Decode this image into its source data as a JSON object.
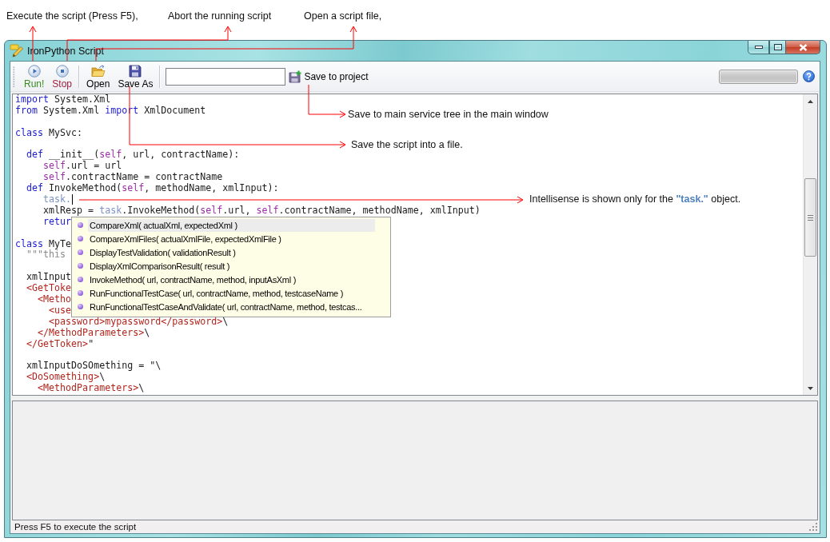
{
  "annotations": {
    "top": [
      "Execute the script (Press F5),",
      "Abort the running script",
      "Open a script file,"
    ],
    "side": [
      "Save to main service tree in the main window",
      "Save the script into a file.",
      "Intellisense is shown only for the **\"task.\"** object."
    ]
  },
  "window": {
    "title": "IronPython Script"
  },
  "toolbar": {
    "buttons": [
      {
        "kind": "run",
        "label": "Run!"
      },
      {
        "kind": "stop",
        "label": "Stop"
      },
      {
        "kind": "open",
        "label": "Open"
      },
      {
        "kind": "save_as",
        "label": "Save As"
      }
    ],
    "save_to_project": "Save to project"
  },
  "editor": {
    "lines": [
      {
        "segments": [
          {
            "kind": "keyword",
            "text": "import"
          },
          {
            "kind": "plain",
            "text": " System.Xml"
          }
        ],
        "caret": false
      },
      {
        "segments": [
          {
            "kind": "keyword",
            "text": "from"
          },
          {
            "kind": "plain",
            "text": " System.Xml "
          },
          {
            "kind": "keyword",
            "text": "import"
          },
          {
            "kind": "plain",
            "text": " XmlDocument"
          }
        ],
        "caret": false
      },
      {
        "caret": false
      },
      {
        "segments": [
          {
            "kind": "keyword",
            "text": "class"
          },
          {
            "kind": "plain",
            "text": " MySvc:"
          }
        ],
        "caret": false
      },
      {
        "caret": false
      },
      {
        "segments": [
          {
            "kind": "keyword",
            "text": "  def"
          },
          {
            "kind": "plain",
            "text": " __init__("
          },
          {
            "kind": "self",
            "text": "self"
          },
          {
            "kind": "plain",
            "text": ", url, contractName):"
          }
        ],
        "caret": false
      },
      {
        "segments": [
          {
            "kind": "self",
            "text": "     self"
          },
          {
            "kind": "plain",
            "text": ".url = url"
          }
        ],
        "caret": false
      },
      {
        "segments": [
          {
            "kind": "self",
            "text": "     self"
          },
          {
            "kind": "plain",
            "text": ".contractName = contractName"
          }
        ],
        "caret": false
      },
      {
        "segments": [
          {
            "kind": "keyword",
            "text": "  def"
          },
          {
            "kind": "plain",
            "text": " InvokeMethod("
          },
          {
            "kind": "self",
            "text": "self"
          },
          {
            "kind": "plain",
            "text": ", methodName, xmlInput):"
          }
        ],
        "caret": false
      },
      {
        "segments": [
          {
            "kind": "task",
            "text": "     task."
          }
        ],
        "caret": true
      },
      {
        "segments": [
          {
            "kind": "plain",
            "text": "     xmlResp = "
          },
          {
            "kind": "task",
            "text": "task"
          },
          {
            "kind": "plain",
            "text": ".InvokeMethod("
          },
          {
            "kind": "self",
            "text": "self"
          },
          {
            "kind": "plain",
            "text": ".url, "
          },
          {
            "kind": "self",
            "text": "self"
          },
          {
            "kind": "plain",
            "text": ".contractName, methodName, xmlInput)"
          }
        ],
        "caret": false
      },
      {
        "segments": [
          {
            "kind": "keyword",
            "text": "     retur"
          }
        ],
        "caret": false
      },
      {
        "caret": false
      },
      {
        "segments": [
          {
            "kind": "keyword",
            "text": "class"
          },
          {
            "kind": "plain",
            "text": " MyTe"
          }
        ],
        "caret": false
      },
      {
        "segments": [
          {
            "kind": "doc",
            "text": "  \"\"\"this"
          }
        ],
        "caret": false
      },
      {
        "caret": false
      },
      {
        "segments": [
          {
            "kind": "plain",
            "text": "  xmlInput"
          }
        ],
        "caret": false
      },
      {
        "segments": [
          {
            "kind": "xml",
            "text": "  <GetToke"
          }
        ],
        "caret": false
      },
      {
        "segments": [
          {
            "kind": "xml",
            "text": "    <Metho"
          }
        ],
        "caret": false
      },
      {
        "segments": [
          {
            "kind": "xml",
            "text": "      <use"
          }
        ],
        "caret": false
      },
      {
        "segments": [
          {
            "kind": "xml",
            "text": "      <password>mypassword</password>"
          },
          {
            "kind": "plain",
            "text": "\\"
          }
        ],
        "caret": false
      },
      {
        "segments": [
          {
            "kind": "xml",
            "text": "    </MethodParameters>"
          },
          {
            "kind": "plain",
            "text": "\\"
          }
        ],
        "caret": false
      },
      {
        "segments": [
          {
            "kind": "xml",
            "text": "  </GetToken>"
          },
          {
            "kind": "plain",
            "text": "\""
          }
        ],
        "caret": false
      },
      {
        "caret": false
      },
      {
        "segments": [
          {
            "kind": "plain",
            "text": "  xmlInputDoSOmething = \"\\"
          }
        ],
        "caret": false
      },
      {
        "segments": [
          {
            "kind": "xml",
            "text": "  <DoSomething>"
          },
          {
            "kind": "plain",
            "text": "\\"
          }
        ],
        "caret": false
      },
      {
        "segments": [
          {
            "kind": "xml",
            "text": "    <MethodParameters>"
          },
          {
            "kind": "plain",
            "text": "\\"
          }
        ],
        "caret": false
      }
    ],
    "completion": {
      "items": [
        {
          "label": "CompareXml( actualXml, expectedXml )",
          "selected": true
        },
        {
          "label": "CompareXmlFiles( actualXmlFile, expectedXmlFile )",
          "selected": false
        },
        {
          "label": "DisplayTestValidation( validationResult )",
          "selected": false
        },
        {
          "label": "DisplayXmlComparisonResult( result )",
          "selected": false
        },
        {
          "label": "InvokeMethod( url, contractName, method, inputAsXml )",
          "selected": false
        },
        {
          "label": "RunFunctionalTestCase( url, contractName, method, testcaseName )",
          "selected": false
        },
        {
          "label": "RunFunctionalTestCaseAndValidate( url, contractName, method, testcas...",
          "selected": false
        }
      ]
    }
  },
  "status_bar": {
    "text": "Press F5 to execute the script"
  }
}
